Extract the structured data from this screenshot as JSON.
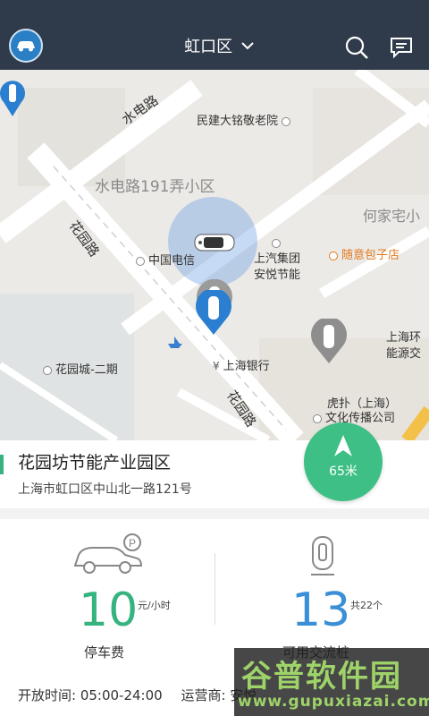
{
  "header": {
    "district": "虹口区"
  },
  "map": {
    "road_shuidian": "水电路",
    "poi_minjian": "民建大铭敬老院",
    "area_xiaoqu": "水电路191弄小区",
    "area_hejia": "何家宅小",
    "poi_zhongguodianxin": "中国电信",
    "poi_shangqi_1": "上汽集团",
    "poi_shangqi_2": "安悦节能",
    "poi_suiyi": "随意包子店",
    "road_huayuan_1": "花园路",
    "road_huayuan_2": "花园路",
    "poi_huayuancheng": "花园城-二期",
    "poi_bank": "上海银行",
    "poi_shanghaihuan_1": "上海环",
    "poi_shanghaihuan_2": "能源交",
    "poi_hupu_1": "虎扑（上海）",
    "poi_hupu_2": "文化传播公司"
  },
  "place": {
    "name": "花园坊节能产业园区",
    "address": "上海市虹口区中山北一路121号"
  },
  "navigate": {
    "distance": "65米"
  },
  "stats": {
    "parking_fee_value": "10",
    "parking_fee_unit": "元/小时",
    "parking_fee_label": "停车费",
    "chargers_value": "13",
    "chargers_total": "共22个",
    "chargers_label": "可用交流桩"
  },
  "footer": {
    "open_hours_label": "开放时间: 05:00-24:00",
    "operator_label": "运营商: 安悦"
  },
  "watermark": {
    "title": "谷普软件园",
    "url": "www.gupuxiazai.com"
  },
  "colors": {
    "header": "#2f3a4a",
    "accent_green": "#36b37e",
    "accent_blue": "#3a8fd6",
    "marker_blue": "#2b7fd0"
  }
}
